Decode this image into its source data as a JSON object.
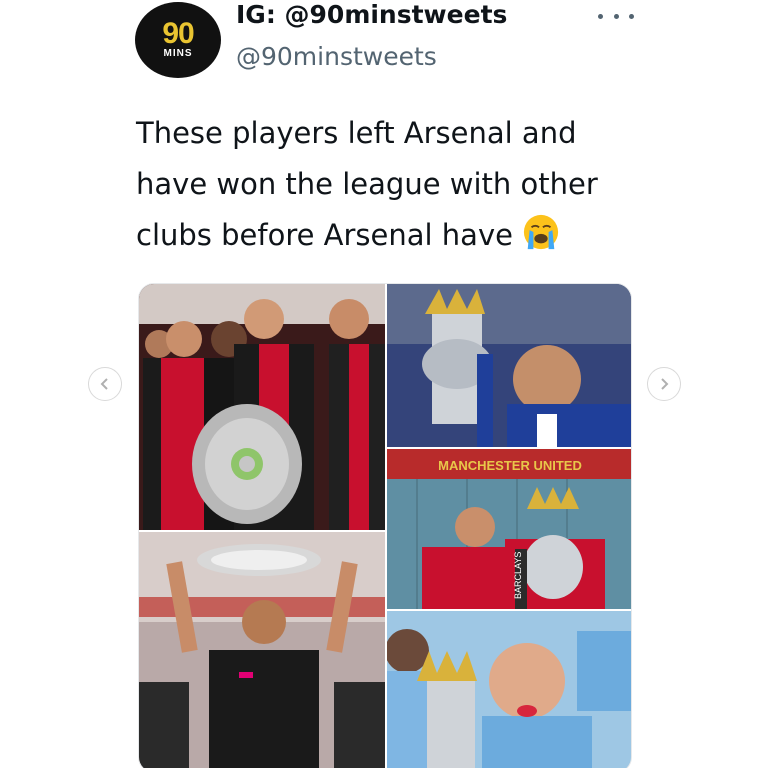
{
  "profile": {
    "avatar_number": "90",
    "avatar_word": "MINS",
    "display_name": "IG: @90minstweets",
    "handle": "@90minstweets"
  },
  "tweet": {
    "text_lines": [
      "These players left Arsenal and",
      "have won the league with other",
      "clubs before Arsenal have"
    ],
    "emoji": "loudly-crying-face"
  },
  "media": {
    "photo_count": 5,
    "signage_text": "MANCHESTER UNITED",
    "sponsor_text": "BARCLAYS"
  },
  "icons": {
    "more": "more-horizontal-icon",
    "prev": "chevron-left-icon",
    "next": "chevron-right-icon"
  },
  "colors": {
    "avatar_bg": "#111111",
    "avatar_accent": "#e9c431",
    "handle_gray": "#536471"
  }
}
